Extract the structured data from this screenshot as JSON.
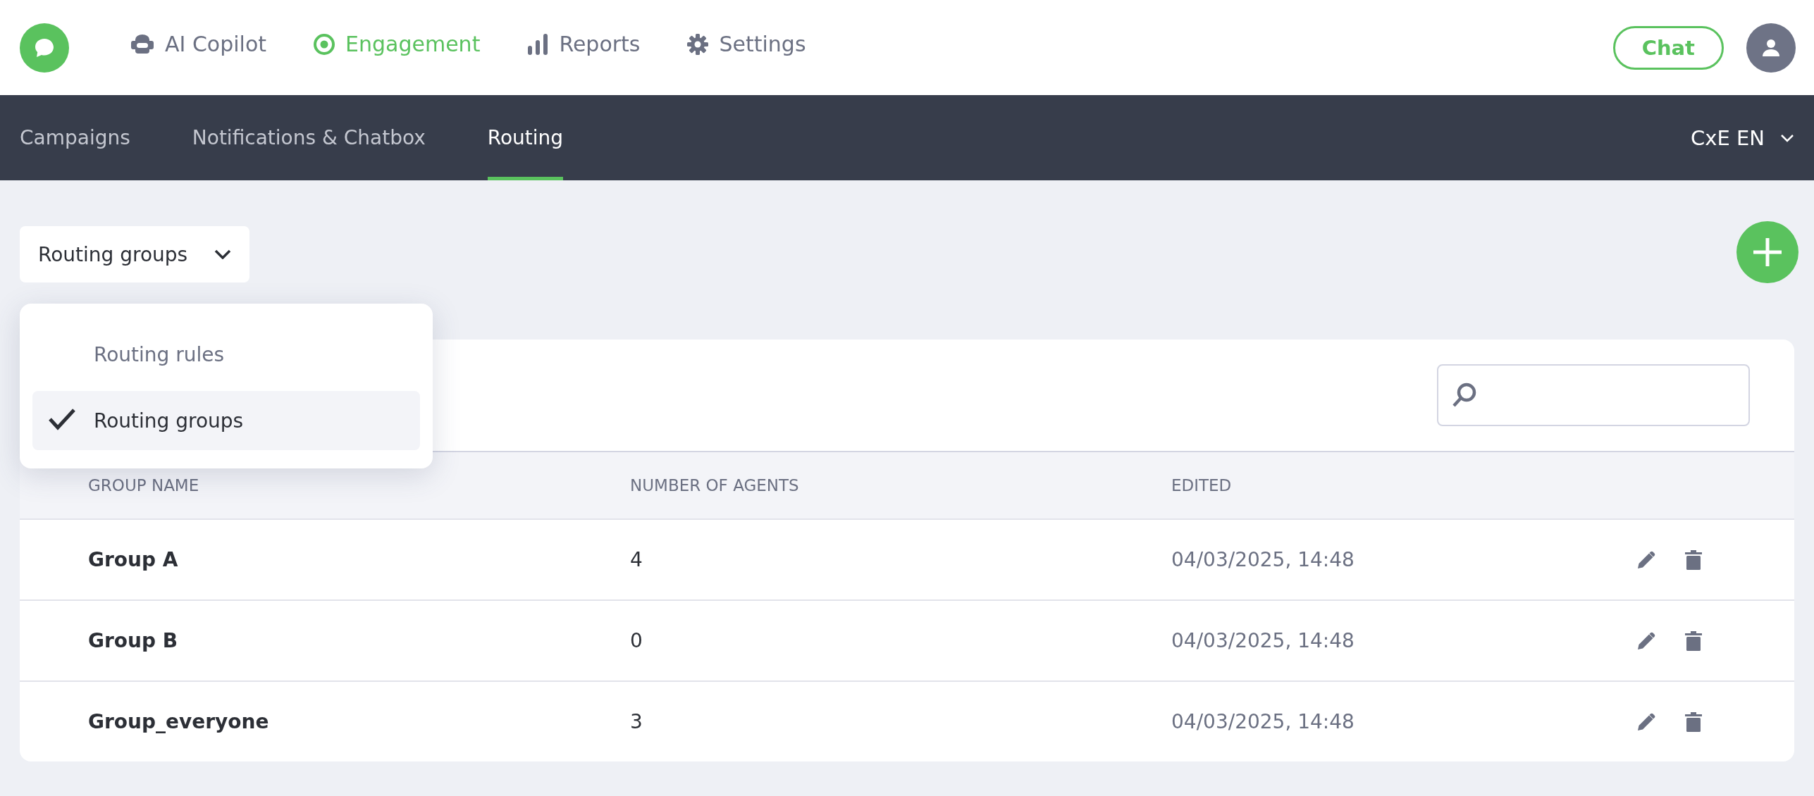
{
  "top_nav": {
    "items": [
      {
        "label": "AI Copilot",
        "selected": false
      },
      {
        "label": "Engagement",
        "selected": true
      },
      {
        "label": "Reports",
        "selected": false
      },
      {
        "label": "Settings",
        "selected": false
      }
    ],
    "chat_button": "Chat"
  },
  "sub_nav": {
    "tabs": [
      {
        "label": "Campaigns",
        "selected": false
      },
      {
        "label": "Notifications & Chatbox",
        "selected": false
      },
      {
        "label": "Routing",
        "selected": true
      }
    ],
    "workspace": "CxE EN"
  },
  "view_select": {
    "value": "Routing groups",
    "options": [
      {
        "label": "Routing rules",
        "selected": false
      },
      {
        "label": "Routing groups",
        "selected": true
      }
    ]
  },
  "table": {
    "columns": [
      "GROUP NAME",
      "NUMBER OF AGENTS",
      "EDITED"
    ],
    "rows": [
      {
        "name": "Group A",
        "agents": "4",
        "edited": "04/03/2025, 14:48"
      },
      {
        "name": "Group B",
        "agents": "0",
        "edited": "04/03/2025, 14:48"
      },
      {
        "name": "Group_everyone",
        "agents": "3",
        "edited": "04/03/2025, 14:48"
      }
    ]
  }
}
